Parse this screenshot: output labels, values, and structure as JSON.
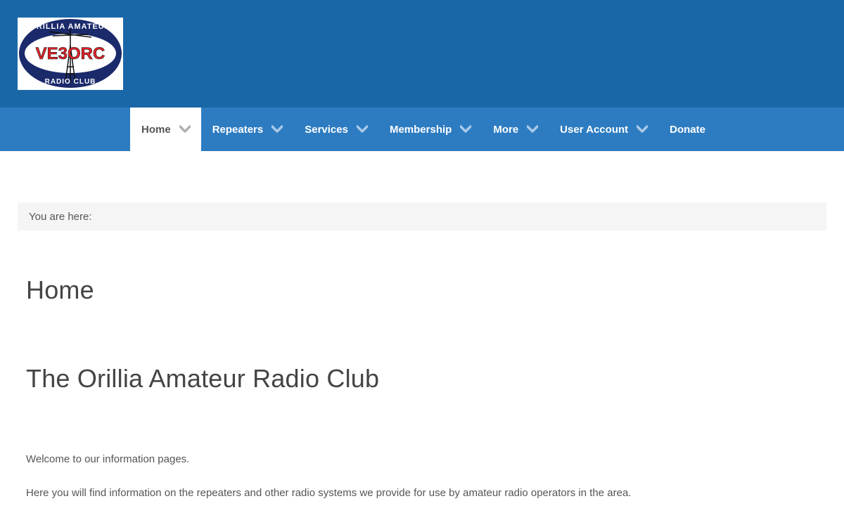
{
  "logo": {
    "top_text": "ORILLIA AMATEUR",
    "callsign": "VE3ORC",
    "bottom_text": "RADIO CLUB"
  },
  "nav": {
    "items": [
      {
        "label": "Home",
        "active": true,
        "has_dropdown": true
      },
      {
        "label": "Repeaters",
        "active": false,
        "has_dropdown": true
      },
      {
        "label": "Services",
        "active": false,
        "has_dropdown": true
      },
      {
        "label": "Membership",
        "active": false,
        "has_dropdown": true
      },
      {
        "label": "More",
        "active": false,
        "has_dropdown": true
      },
      {
        "label": "User Account",
        "active": false,
        "has_dropdown": true
      },
      {
        "label": "Donate",
        "active": false,
        "has_dropdown": false
      }
    ]
  },
  "breadcrumb": {
    "label": "You are here:"
  },
  "page": {
    "title": "Home",
    "article_title": "The Orillia Amateur Radio Club",
    "paragraphs": [
      "Welcome to our information pages.",
      "Here you will find information on the repeaters and other radio systems we provide for use by amateur radio operators in the area."
    ]
  },
  "colors": {
    "header_bg": "#1a67a8",
    "nav_bg": "#2d7cc1",
    "logo_red": "#e8232a",
    "logo_navy": "#1b2a6b"
  }
}
